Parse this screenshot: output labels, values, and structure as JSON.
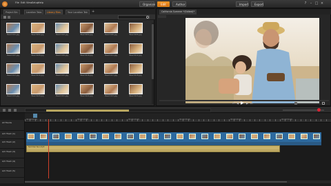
{
  "menu": [
    "File",
    "Edit",
    "View",
    "Setup",
    "Help"
  ],
  "modes": [
    "Organize",
    "Edit",
    "Author"
  ],
  "actions": [
    "Import",
    "Export"
  ],
  "library": {
    "tabs": [
      "Project Bin",
      "Location Tabs",
      "Library Files",
      "Your Location Tab"
    ],
    "active_tab": 2,
    "grid_rows": [
      [
        "Beach001.jpg",
        "Beach002.jpg",
        "Beach003.jpg",
        "Beach004.jpg",
        "Beach005.jpg",
        "Beach006.jpg"
      ],
      [
        "Beach007.jpg",
        "Beach008.jpg",
        "Beach009.jpg",
        "Beach010.jpg",
        "Beach011.jpg",
        "Beach012.jpg"
      ],
      [
        "Beach013.jpg",
        "Beach014.jpg",
        "Beach015.jpg",
        "Beach016.jpg",
        "Beach017.jpg",
        "Beach018.jpg"
      ],
      [
        "Beach019.jpg",
        "Beach020.jpg",
        "Beach021.jpg",
        "Beach022.jpg",
        "Beach023.jpg",
        "Beach024.jpg"
      ]
    ]
  },
  "preview": {
    "title": "California Summer *(Edited)*"
  },
  "timeline": {
    "tracks": [
      "All Tracks",
      "A/V Track (1)",
      "A/V Track (2)",
      "A/V Track (3)",
      "A/V Track (4)",
      "A/V Track (5)"
    ],
    "ruler_labels": [
      "00:00:00.00",
      "00:00:10.00",
      "00:00:20.00",
      "00:00:30.00",
      "00:00:40.00",
      "00:00:50.00"
    ],
    "audio_clip_label": "Summer Sun.mp3"
  },
  "colors": {
    "accent": "#f08a22",
    "clip_video": "#2d6a9f",
    "clip_audio": "#c9b36b"
  }
}
